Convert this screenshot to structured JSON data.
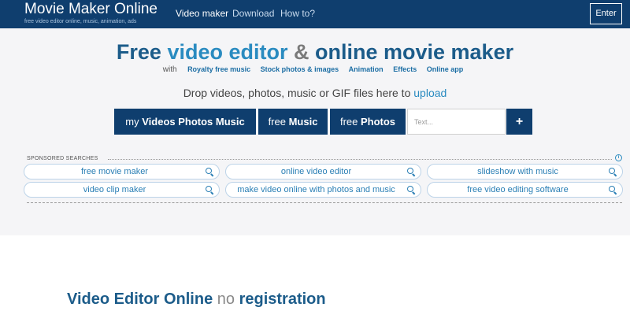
{
  "header": {
    "brand": "Movie Maker Online",
    "tagline": "free video editor online, music, animation, ads",
    "nav": [
      "Video maker",
      "Download",
      "How to?"
    ],
    "enter_label": "Enter",
    "bg_color": "#0f3e6e"
  },
  "hero": {
    "headline": {
      "part1": "Free",
      "part2": "video editor",
      "part3": "&",
      "part4": "online movie maker"
    },
    "with_label": "with",
    "sublinks": [
      "Royalty free music",
      "Stock photos & images",
      "Animation",
      "Effects",
      "Online app"
    ],
    "drop_text": "Drop videos, photos, music or GIF files here to",
    "upload_label": "upload",
    "buttons": {
      "my_prefix": "my",
      "my_bold": "Videos Photos Music",
      "music_prefix": "free",
      "music_bold": "Music",
      "photos_prefix": "free",
      "photos_bold": "Photos"
    },
    "text_placeholder": "Text...",
    "plus_label": "+"
  },
  "sponsored": {
    "label": "SPONSORED SEARCHES",
    "info_label": "i",
    "items": [
      "free movie maker",
      "online video editor",
      "slideshow with music",
      "video clip maker",
      "make video online with photos and music",
      "free video editing software"
    ]
  },
  "section": {
    "title_part1": "Video Editor Online",
    "title_part2": "no",
    "title_part3": "registration"
  }
}
